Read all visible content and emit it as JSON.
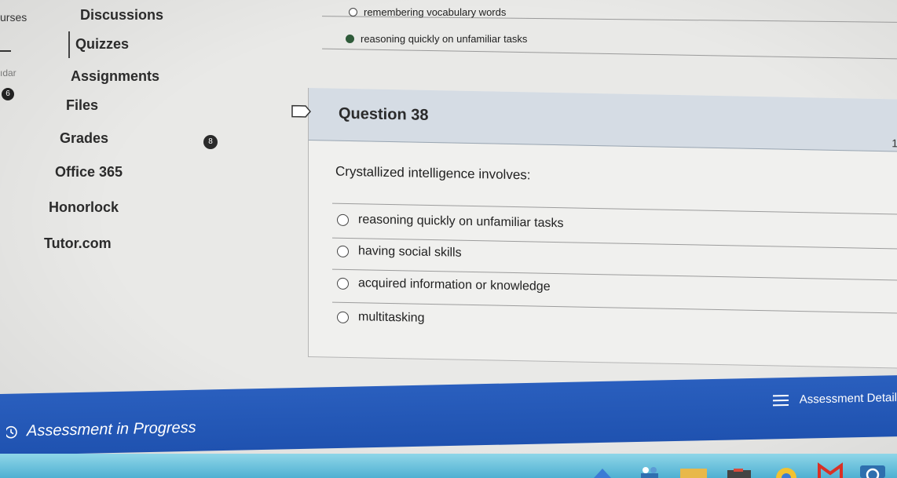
{
  "edge_fragments": {
    "courses": "urses",
    "calendar": "ıdar",
    "badge": "6"
  },
  "sidebar": {
    "items": [
      {
        "label": "Discussions"
      },
      {
        "label": "Quizzes"
      },
      {
        "label": "Assignments"
      },
      {
        "label": "Files"
      },
      {
        "label": "Grades"
      },
      {
        "label": "Office 365"
      },
      {
        "label": "Honorlock"
      },
      {
        "label": "Tutor.com"
      }
    ],
    "unread_count": "8"
  },
  "previous_question": {
    "options": [
      {
        "label": "remembering vocabulary words",
        "selected": false
      },
      {
        "label": "reasoning quickly on unfamiliar tasks",
        "selected": true
      }
    ]
  },
  "question": {
    "title": "Question 38",
    "points_fragment": "1",
    "prompt": "Crystallized intelligence involves:",
    "options": [
      {
        "label": "reasoning quickly on unfamiliar tasks"
      },
      {
        "label": "having social skills"
      },
      {
        "label": "acquired information or knowledge"
      },
      {
        "label": "multitasking"
      }
    ]
  },
  "assessment_bar": {
    "status": "Assessment in Progress",
    "details_label": "Assessment Detail",
    "color": "#1f52b0"
  },
  "taskbar": {
    "icons": [
      "app-icon",
      "triangle-icon",
      "people-icon",
      "folder-icon",
      "calendar-icon",
      "chrome-icon",
      "gmail-icon",
      "circle-app-icon"
    ]
  }
}
